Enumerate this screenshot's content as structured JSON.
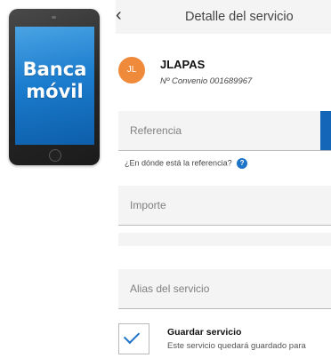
{
  "promo": {
    "text": "Banca\nmóvil",
    "screen_color": "#1c7dcf"
  },
  "header": {
    "back_icon": "chevron-left-icon",
    "back_glyph": "‹",
    "title": "Detalle del servicio"
  },
  "service": {
    "avatar_initials": "JL",
    "avatar_color": "#ef8a3b",
    "name": "JLAPAS",
    "convenio": "Nº Convenio 001689967"
  },
  "form": {
    "referencia_label": "Referencia",
    "referencia_hint": "¿En dónde está la referencia?",
    "help_glyph": "?",
    "importe_label": "Importe",
    "alias_label": "Alias del servicio"
  },
  "save": {
    "checked": true,
    "title": "Guardar servicio",
    "description": "Este servicio quedará guardado para"
  },
  "colors": {
    "accent": "#1467b8",
    "field_bg": "#f4f4f4"
  }
}
